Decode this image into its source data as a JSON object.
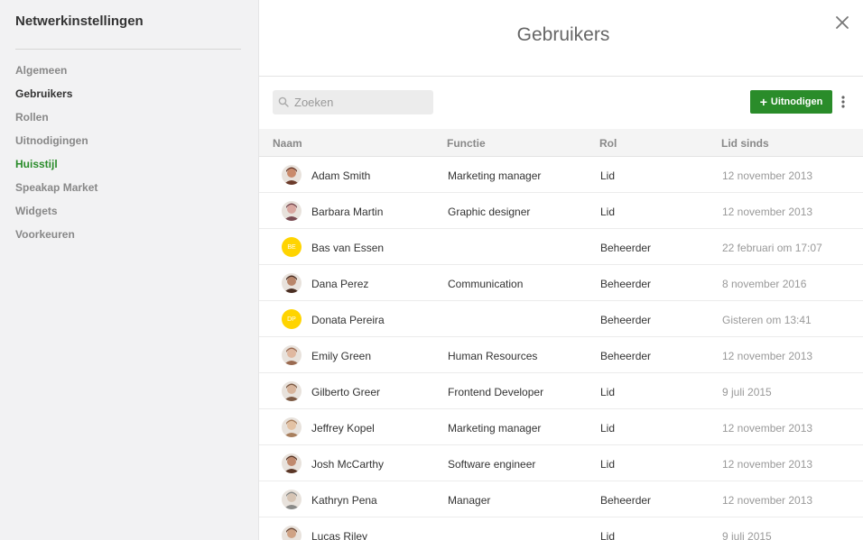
{
  "sidebar": {
    "title": "Netwerkinstellingen",
    "items": [
      {
        "label": "Algemeen"
      },
      {
        "label": "Gebruikers"
      },
      {
        "label": "Rollen"
      },
      {
        "label": "Uitnodigingen"
      },
      {
        "label": "Huisstijl"
      },
      {
        "label": "Speakap Market"
      },
      {
        "label": "Widgets"
      },
      {
        "label": "Voorkeuren"
      }
    ],
    "active_item": "Gebruikers"
  },
  "header": {
    "title": "Gebruikers",
    "close_icon": "close-icon"
  },
  "toolbar": {
    "search_placeholder": "Zoeken",
    "invite_label": "Uitnodigen",
    "brand_color": "#2a8c2a"
  },
  "table": {
    "columns": [
      "Naam",
      "Functie",
      "Rol",
      "Lid sinds"
    ],
    "rows": [
      {
        "name": "Adam Smith",
        "function": "Marketing manager",
        "role": "Lid",
        "since": "12 november 2013"
      },
      {
        "name": "Barbara Martin",
        "function": "Graphic designer",
        "role": "Lid",
        "since": "12 november 2013"
      },
      {
        "name": "Bas van Essen",
        "function": "",
        "role": "Beheerder",
        "since": "22 februari om 17:07",
        "initials": "BE"
      },
      {
        "name": "Dana Perez",
        "function": "Communication",
        "role": "Beheerder",
        "since": "8 november 2016"
      },
      {
        "name": "Donata Pereira",
        "function": "",
        "role": "Beheerder",
        "since": "Gisteren om 13:41",
        "initials": "DP"
      },
      {
        "name": "Emily Green",
        "function": "Human Resources",
        "role": "Beheerder",
        "since": "12 november 2013"
      },
      {
        "name": "Gilberto Greer",
        "function": "Frontend Developer",
        "role": "Lid",
        "since": "9 juli 2015"
      },
      {
        "name": "Jeffrey Kopel",
        "function": "Marketing manager",
        "role": "Lid",
        "since": "12 november 2013"
      },
      {
        "name": "Josh McCarthy",
        "function": "Software engineer",
        "role": "Lid",
        "since": "12 november 2013"
      },
      {
        "name": "Kathryn Pena",
        "function": "Manager",
        "role": "Beheerder",
        "since": "12 november 2013"
      },
      {
        "name": "Lucas Riley",
        "function": "",
        "role": "Lid",
        "since": "9 juli 2015"
      }
    ]
  }
}
